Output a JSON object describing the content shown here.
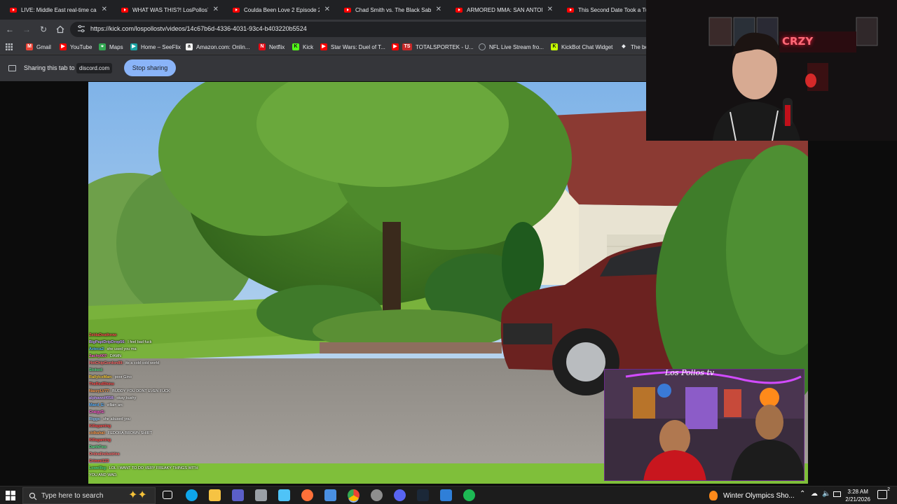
{
  "browser": {
    "tabs": [
      {
        "title": "LIVE: Middle East real-time cam"
      },
      {
        "title": "WHAT WAS THIS?! LosPollosTV"
      },
      {
        "title": "Coulda Been Love 2 Episode 2"
      },
      {
        "title": "Chad Smith vs. The Black Sabbath"
      },
      {
        "title": "ARMORED MMA: SAN ANTONIO"
      },
      {
        "title": "This Second Date Took a Turn"
      }
    ],
    "url": "https://kick.com/lospollostv/videos/14c67b6d-4336-4031-93c4-b403220b5524",
    "bookmarks": [
      {
        "label": "Gmail",
        "icon": "gmail-icon",
        "color": "#ea4335"
      },
      {
        "label": "YouTube",
        "icon": "youtube-icon",
        "color": "#ff0000"
      },
      {
        "label": "Maps",
        "icon": "maps-icon",
        "color": "#34a853"
      },
      {
        "label": "Home – SeeFlix",
        "icon": "seeflix-icon",
        "color": "#1aa3a3"
      },
      {
        "label": "Amazon.com: Onlin...",
        "icon": "amazon-icon",
        "color": "#f2f2f2"
      },
      {
        "label": "Netflix",
        "icon": "netflix-icon",
        "color": "#e50914"
      },
      {
        "label": "Kick",
        "icon": "kick-icon",
        "color": "#53fc18"
      },
      {
        "label": "Star Wars: Duel of T...",
        "icon": "youtube-icon",
        "color": "#ff0000"
      },
      {
        "label": "TOTALSPORTEK - U...",
        "icon": "totalsportek-icon",
        "color": "#c62828"
      },
      {
        "label": "NFL Live Stream fro...",
        "icon": "globe-icon",
        "color": "#9aa0a6"
      },
      {
        "label": "KickBot Chat Widget",
        "icon": "kickbot-icon",
        "color": "#c6ff00"
      },
      {
        "label": "The be",
        "icon": "diamond-icon",
        "color": "#e8eaed"
      }
    ],
    "share_text": "Sharing this tab to",
    "share_domain": "discord.com",
    "stop_sharing": "Stop sharing"
  },
  "webcam": {
    "sign_text": "CRZY"
  },
  "overlay_cam": {
    "signature": "Los Pollos tv"
  },
  "chat": [
    {
      "user": "ZeldaDeathrow",
      "msg": "",
      "color": "#ff4d4d"
    },
    {
      "user": "BigPapiDripDrop56:",
      "msg": "I feel bad fuck",
      "color": "#c9a0ff"
    },
    {
      "user": "Azteca2:",
      "msg": "she used you ma",
      "color": "#5ab4ff"
    },
    {
      "user": "Zachy007:",
      "msg": "DAMN",
      "color": "#ff5ad2"
    },
    {
      "user": "HotChipGordon89:",
      "msg": "its a cold cold world",
      "color": "#ff6b6b"
    },
    {
      "user": "Stoked:",
      "msg": "",
      "color": "#57e389"
    },
    {
      "user": "RallyIceMan:",
      "msg": "poor Gino",
      "color": "#ffd23f"
    },
    {
      "user": "TheRedRhino",
      "msg": "",
      "color": "#ff4d4d"
    },
    {
      "user": "NazzyLV77:",
      "msg": "BUDDY YOU DONT EVEN FUCK",
      "color": "#ff9b4d"
    },
    {
      "user": "alphawolf058:",
      "msg": "okay bushy",
      "color": "#c9a0ff"
    },
    {
      "user": "Maed_E:",
      "msg": "villain arc",
      "color": "#5ab4ff"
    },
    {
      "user": "CraigyS:",
      "msg": "",
      "color": "#ff5ad2"
    },
    {
      "user": "Riggs:",
      "msg": "she abused you",
      "color": "#9ad0ff"
    },
    {
      "user": "Killagaming",
      "msg": "",
      "color": "#ff4d4d"
    },
    {
      "user": "cidkahal:",
      "msg": "FEDORA BROWN SHIRT",
      "color": "#ff9b4d"
    },
    {
      "user": "Killagaming",
      "msg": "",
      "color": "#ff4d4d"
    },
    {
      "user": "DarthFeo:",
      "msg": "",
      "color": "#57e389"
    },
    {
      "user": "OrdealIndustries",
      "msg": "",
      "color": "#ff6b6b"
    },
    {
      "user": "Crimmi123",
      "msg": "",
      "color": "#ff4d4d"
    },
    {
      "user": "Lowellbg:",
      "msg": "LOL I WANT TO DO VERY FREAKY THINGS WITH",
      "color": "#57e389"
    },
    {
      "user": "",
      "msg": "YOU AND WAD.",
      "color": "#ffffff"
    }
  ],
  "taskbar": {
    "search_placeholder": "Type here to search",
    "weather_text": "Winter Olympics Sho...",
    "time": "3:28 AM",
    "date": "2/21/2026",
    "notification_count": "2",
    "apps": [
      {
        "name": "task-view-icon",
        "color": "#ffffff"
      },
      {
        "name": "edge-icon",
        "color": "#0ea5e9"
      },
      {
        "name": "file-explorer-icon",
        "color": "#f6c343"
      },
      {
        "name": "calculator-icon",
        "color": "#5b5fc7"
      },
      {
        "name": "app-icon-1",
        "color": "#9aa0a6"
      },
      {
        "name": "app-icon-2",
        "color": "#4fc3f7"
      },
      {
        "name": "firefox-icon",
        "color": "#ff7139"
      },
      {
        "name": "app-icon-3",
        "color": "#4a90e2"
      },
      {
        "name": "chrome-icon",
        "color": "#34a853"
      },
      {
        "name": "obs-icon",
        "color": "#8e8e8e"
      },
      {
        "name": "discord-icon",
        "color": "#5865f2"
      },
      {
        "name": "steam-icon",
        "color": "#1b2838"
      },
      {
        "name": "photos-icon",
        "color": "#2f7fd8"
      },
      {
        "name": "spotify-icon",
        "color": "#1db954"
      }
    ]
  }
}
